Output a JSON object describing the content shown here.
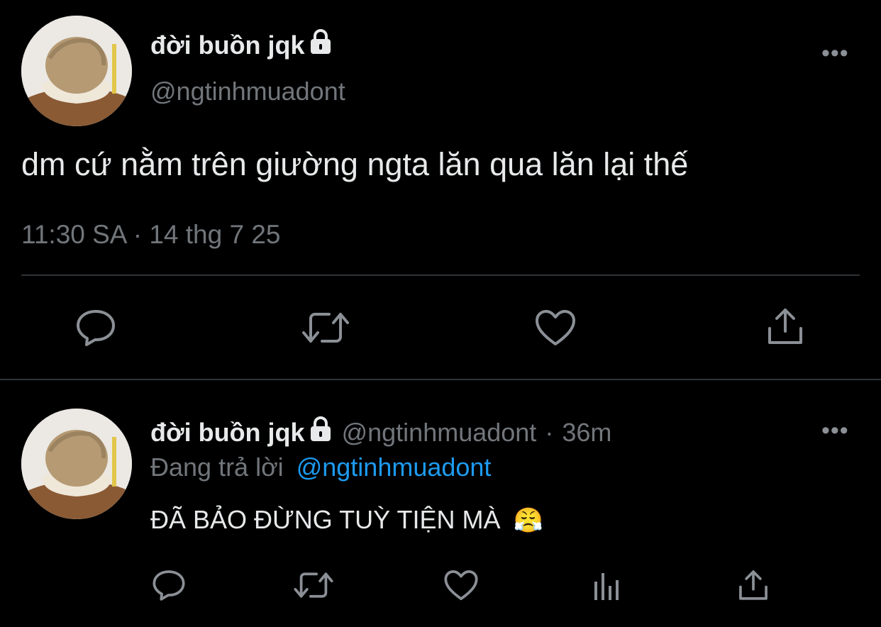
{
  "main_tweet": {
    "display_name": "đời buồn jqk",
    "handle": "@ngtinhmuadont",
    "text": "dm cứ nằm trên giường ngta lăn qua lăn lại thế",
    "meta": "11:30 SA · 14 thg 7 25",
    "more_label": "•••"
  },
  "reply_tweet": {
    "display_name": "đời buồn jqk",
    "handle": "@ngtinhmuadont",
    "separator": "·",
    "time": "36m",
    "replying_label": "Đang trả lời",
    "replying_to": "@ngtinhmuadont",
    "text": "ĐÃ BẢO ĐỪNG TUỲ TIỆN MÀ",
    "emoji": "😤",
    "more_label": "•••"
  },
  "icons": {
    "reply": "speech-bubble-icon",
    "retweet": "retweet-icon",
    "like": "heart-icon",
    "share": "share-icon",
    "views": "bar-chart-icon",
    "lock": "lock-icon"
  },
  "colors": {
    "background": "#000000",
    "text": "#e7e9ea",
    "muted": "#71767b",
    "link": "#1d9bf0",
    "divider": "#2f3336"
  }
}
